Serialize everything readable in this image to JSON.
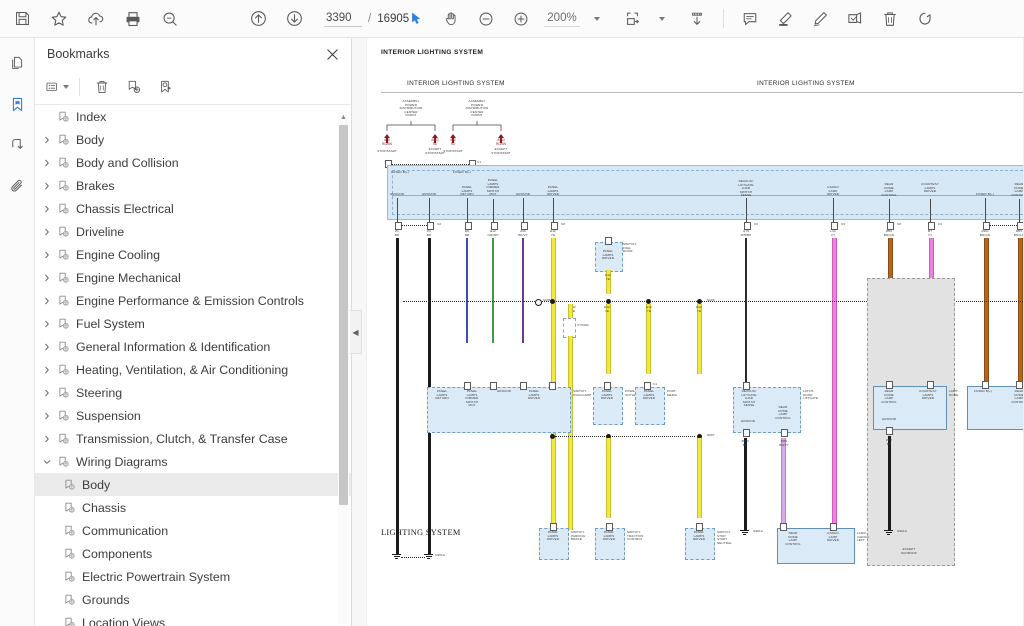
{
  "app": {
    "title": "PDF Reader"
  },
  "toolbar": {
    "left_buttons": [
      {
        "name": "save-button",
        "icon": "save-icon",
        "label": "Save"
      },
      {
        "name": "favorite-button",
        "icon": "star-icon",
        "label": "Add to favorites"
      },
      {
        "name": "upload-cloud-button",
        "icon": "cloud-upload-icon",
        "label": "Upload to cloud"
      },
      {
        "name": "print-button",
        "icon": "printer-icon",
        "label": "Print"
      },
      {
        "name": "search-button",
        "icon": "search-icon",
        "label": "Find"
      }
    ],
    "previous_page_label": "Previous page",
    "next_page_label": "Next page",
    "page_number": "3390",
    "page_separator": "/",
    "page_total": "16905",
    "select_tool_label": "Select tool",
    "pan_tool_label": "Hand tool",
    "zoom_out_label": "Zoom out",
    "zoom_in_label": "Zoom in",
    "zoom_value": "200%",
    "fit_page_label": "Fit page",
    "scroll_mode_label": "Page view mode",
    "comment_label": "Comment",
    "highlight_label": "Highlight",
    "draw_label": "Freehand draw",
    "stamp_label": "Stamp",
    "delete_label": "Delete",
    "rotate_label": "Rotate"
  },
  "rail": [
    {
      "name": "sidebar-icon-thumbnails",
      "icon": "pages-icon",
      "label": "Page thumbnails",
      "active": false
    },
    {
      "name": "sidebar-icon-bookmarks",
      "icon": "bookmark-icon",
      "label": "Bookmarks",
      "active": true
    },
    {
      "name": "sidebar-icon-signature",
      "icon": "signature-icon",
      "label": "Signatures",
      "active": false
    },
    {
      "name": "sidebar-icon-attachments",
      "icon": "paperclip-icon",
      "label": "Attachments",
      "active": false
    }
  ],
  "panel": {
    "title": "Bookmarks",
    "close_label": "Close",
    "tools": [
      {
        "name": "bookmark-options-button",
        "icon": "list-options-icon",
        "label": "Options"
      },
      {
        "name": "delete-bookmark-button",
        "icon": "trash-icon",
        "label": "Delete bookmark"
      },
      {
        "name": "add-bookmark-button",
        "icon": "bookmark-add-icon",
        "label": "New bookmark"
      },
      {
        "name": "edit-bookmark-button",
        "icon": "bookmark-edit-icon",
        "label": "Edit bookmark"
      }
    ],
    "tree": [
      {
        "label": "Index",
        "level": 1,
        "expandable": false,
        "expanded": false,
        "selected": false
      },
      {
        "label": "Body",
        "level": 1,
        "expandable": true,
        "expanded": false,
        "selected": false
      },
      {
        "label": "Body and Collision",
        "level": 1,
        "expandable": true,
        "expanded": false,
        "selected": false
      },
      {
        "label": "Brakes",
        "level": 1,
        "expandable": true,
        "expanded": false,
        "selected": false
      },
      {
        "label": "Chassis Electrical",
        "level": 1,
        "expandable": true,
        "expanded": false,
        "selected": false
      },
      {
        "label": "Driveline",
        "level": 1,
        "expandable": true,
        "expanded": false,
        "selected": false
      },
      {
        "label": "Engine Cooling",
        "level": 1,
        "expandable": true,
        "expanded": false,
        "selected": false
      },
      {
        "label": "Engine Mechanical",
        "level": 1,
        "expandable": true,
        "expanded": false,
        "selected": false
      },
      {
        "label": "Engine Performance & Emission Controls",
        "level": 1,
        "expandable": true,
        "expanded": false,
        "selected": false
      },
      {
        "label": "Fuel System",
        "level": 1,
        "expandable": true,
        "expanded": false,
        "selected": false
      },
      {
        "label": "General Information & Identification",
        "level": 1,
        "expandable": true,
        "expanded": false,
        "selected": false
      },
      {
        "label": "Heating, Ventilation, & Air Conditioning",
        "level": 1,
        "expandable": true,
        "expanded": false,
        "selected": false
      },
      {
        "label": "Steering",
        "level": 1,
        "expandable": true,
        "expanded": false,
        "selected": false
      },
      {
        "label": "Suspension",
        "level": 1,
        "expandable": true,
        "expanded": false,
        "selected": false
      },
      {
        "label": "Transmission, Clutch, & Transfer Case",
        "level": 1,
        "expandable": true,
        "expanded": false,
        "selected": false
      },
      {
        "label": "Wiring Diagrams",
        "level": 1,
        "expandable": true,
        "expanded": true,
        "selected": false
      },
      {
        "label": "Body",
        "level": 2,
        "expandable": false,
        "expanded": false,
        "selected": true
      },
      {
        "label": "Chassis",
        "level": 2,
        "expandable": false,
        "expanded": false,
        "selected": false
      },
      {
        "label": "Communication",
        "level": 2,
        "expandable": false,
        "expanded": false,
        "selected": false
      },
      {
        "label": "Components",
        "level": 2,
        "expandable": false,
        "expanded": false,
        "selected": false
      },
      {
        "label": "Electric Powertrain System",
        "level": 2,
        "expandable": false,
        "expanded": false,
        "selected": false
      },
      {
        "label": "Grounds",
        "level": 2,
        "expandable": false,
        "expanded": false,
        "selected": false
      },
      {
        "label": "Location Views",
        "level": 2,
        "expandable": false,
        "expanded": false,
        "selected": false
      }
    ]
  },
  "document": {
    "header_title": "INTERIOR LIGHTING SYSTEM",
    "header_left": "INTERIOR LIGHTING SYSTEM",
    "header_right": "INTERIOR LIGHTING SYSTEM",
    "footer_title": "LIGHTING SYSTEM",
    "fuse_blocks": [
      {
        "title": "ASSEMBLY\nPOWER\nDISTRIBUTION\nCENTER\nFRONT",
        "fuses": [
          {
            "id": "A98",
            "rating": "RD/BN",
            "note": "STOP/START"
          },
          {
            "id": "A903",
            "rating": "RD",
            "note": "EXCEPT\nSTOP/START"
          }
        ]
      },
      {
        "title": "ASSEMBLY\nPOWER\nDISTRIBUTION\nCENTER\nFRONT",
        "fuses": [
          {
            "id": "A90",
            "rating": "RD",
            "note": "STOP/START"
          },
          {
            "id": "A904",
            "rating": "RD/BN",
            "note": "EXCEPT\nSTOP/START"
          }
        ]
      }
    ],
    "bus_labels_top": [
      "FUSED B(+)",
      "FUSED B(+)"
    ],
    "bus_signals": [
      "GROUND",
      "GROUND",
      "PANEL\nLAMPS\nRETURN",
      "PANEL\nLAMPS\nDIMMER\nSWITCH\nMUX",
      "GROUND",
      "PANEL\nLAMPS\nDRIVER",
      "DECKLID/\nLIFTGATE\nAJAR\nSWITCH\nSENSE",
      "CARGO\nLAMP\nDRIVER",
      "REAR\nDOME\nLAMP\nCONTROL",
      "COURTESY\nLAMPS\nDRIVER",
      "FUSED B(+)",
      "REAR\nDOME\nLAMP\nCONTROL"
    ],
    "components": [
      {
        "labels": [
          "PANEL\nLAMPS\nRETURN",
          "PANEL\nLAMPS\nDIMMER\nSWITCH\nMUX",
          "GROUND",
          "PANEL\nLAMPS\nDRIVER"
        ],
        "name": "SWITCH-\nHVAC/LAMP"
      },
      {
        "labels": [
          "PANEL\nLAMPS\nDRIVER"
        ],
        "name": "POWER\nOUTLET"
      },
      {
        "labels": [
          "PANEL\nLAMPS\nDRIVER"
        ],
        "name": "PORT-\nMEDIA"
      },
      {
        "labels": [
          "PANEL\nLAMPS\nDRIVER"
        ],
        "name": "SWITCH-\nFUEL\nDOOR"
      },
      {
        "labels": [
          "DECKLID/\nLIFTGATE\nAJAR\nSWITCH\nSENSE",
          "GROUND",
          "REAR\nDOME\nLAMP\nCONTROL"
        ],
        "name": "LATCH-\nDOOR\nLIFTGATE"
      },
      {
        "labels": [
          "REAR\nDOME\nLAMP\nCONTROL",
          "COURTESY\nLAMPS\nDRIVER",
          "GROUND"
        ],
        "name": "LAMP-\nDOME"
      },
      {
        "labels": [
          "FUSED B(+)",
          "REAR\nDOME\nLAMP\nCONTROL"
        ],
        "name": ""
      },
      {
        "labels": [
          "PANEL\nLAMPS\nDRIVER"
        ],
        "name": "SWITCH-\nPARKING\nBRAKE"
      },
      {
        "labels": [
          "PANEL\nLAMPS\nDRIVER"
        ],
        "name": "SWITCH-\nTRACTION\nCONTROL"
      },
      {
        "labels": [
          "PANEL\nLAMPS\nDRIVER"
        ],
        "name": "SWITCH-\nSTOP\nSTART\nNEUTRAL"
      },
      {
        "labels": [
          "REAR\nDOME\nLAMP\nCONTROL",
          "CARGO\nLAMP\nDRIVER"
        ],
        "name": "LAMP-\nCARGO\nLEFT"
      }
    ],
    "wire_codes": [
      {
        "code": "Z1",
        "color": "BK"
      },
      {
        "code": "Z1",
        "color": "BK"
      },
      {
        "code": "E6",
        "color": "DB"
      },
      {
        "code": "E12",
        "color": "GN/WH"
      },
      {
        "code": "Z46",
        "color": "BK/YT"
      },
      {
        "code": "E12",
        "color": "YE"
      },
      {
        "code": "E12",
        "color": "YE"
      },
      {
        "code": "G79",
        "color": "WH/BK"
      },
      {
        "code": "L14",
        "color": "VT"
      },
      {
        "code": "M53",
        "color": "BN/VIOL"
      },
      {
        "code": "M7",
        "color": "VT"
      },
      {
        "code": "A901",
        "color": "BN/GN"
      },
      {
        "code": "M53",
        "color": "BN/GN"
      },
      {
        "code": "Z603",
        "color": "BK"
      },
      {
        "code": "M53",
        "color": "BN/VT"
      },
      {
        "code": "ZH2",
        "color": "BK"
      }
    ],
    "splice_labels": [
      "S006",
      "S006",
      "S007",
      "XY940A"
    ],
    "ground_labels": [
      "G901A",
      "G901A",
      "G901A",
      "G901A"
    ],
    "section_note": "EXCEPT\nSUNROOF",
    "connector_pins": [
      "C1",
      "C2",
      "C3",
      "C6",
      "C8"
    ]
  },
  "colors": {
    "accent": "#2f7fe0",
    "toolbar_bg": "#fbfbfb",
    "panel_bg": "#ffffff",
    "selection_bg": "#ebebeb",
    "diagram_blue": "#d6e7f5",
    "diagram_blue_border": "#9fb9d1",
    "wire_yellow": "#f2ea3a",
    "wire_pink": "#ef7fe0",
    "wire_brown": "#b5651d",
    "wire_black": "#1a1a1a",
    "fuse_red": "#8d1a1a"
  }
}
